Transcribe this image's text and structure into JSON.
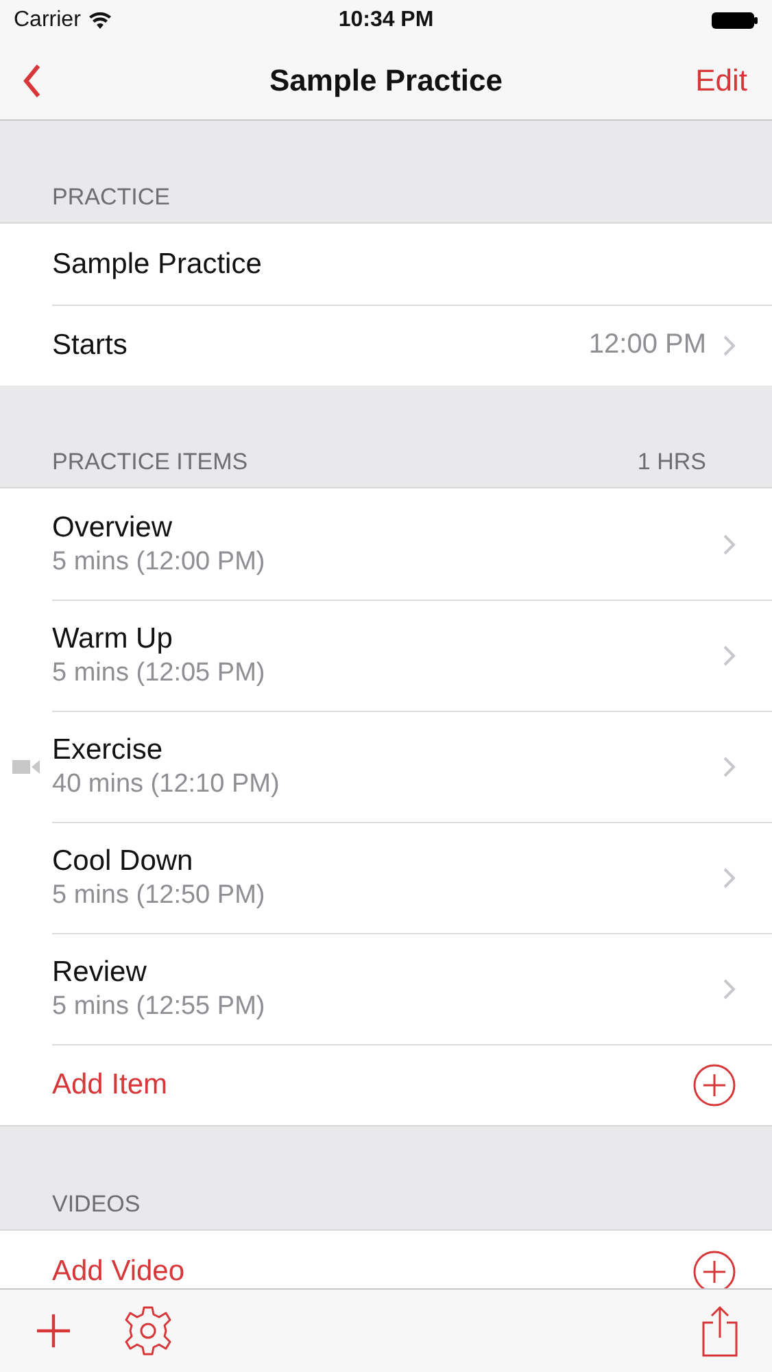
{
  "status_bar": {
    "carrier": "Carrier",
    "time": "10:34 PM"
  },
  "nav": {
    "title": "Sample Practice",
    "action": "Edit"
  },
  "practice": {
    "header": "PRACTICE",
    "name": "Sample Practice",
    "starts_label": "Starts",
    "starts_value": "12:00 PM"
  },
  "practice_items": {
    "header": "PRACTICE ITEMS",
    "total": "1 HRS",
    "items": [
      {
        "title": "Overview",
        "detail": "5 mins (12:00 PM)",
        "has_video": false
      },
      {
        "title": "Warm Up",
        "detail": "5 mins (12:05 PM)",
        "has_video": false
      },
      {
        "title": "Exercise",
        "detail": "40 mins (12:10 PM)",
        "has_video": true
      },
      {
        "title": "Cool Down",
        "detail": "5 mins (12:50 PM)",
        "has_video": false
      },
      {
        "title": "Review",
        "detail": "5 mins (12:55 PM)",
        "has_video": false
      }
    ],
    "add_label": "Add Item"
  },
  "videos": {
    "header": "VIDEOS",
    "add_label": "Add Video"
  }
}
